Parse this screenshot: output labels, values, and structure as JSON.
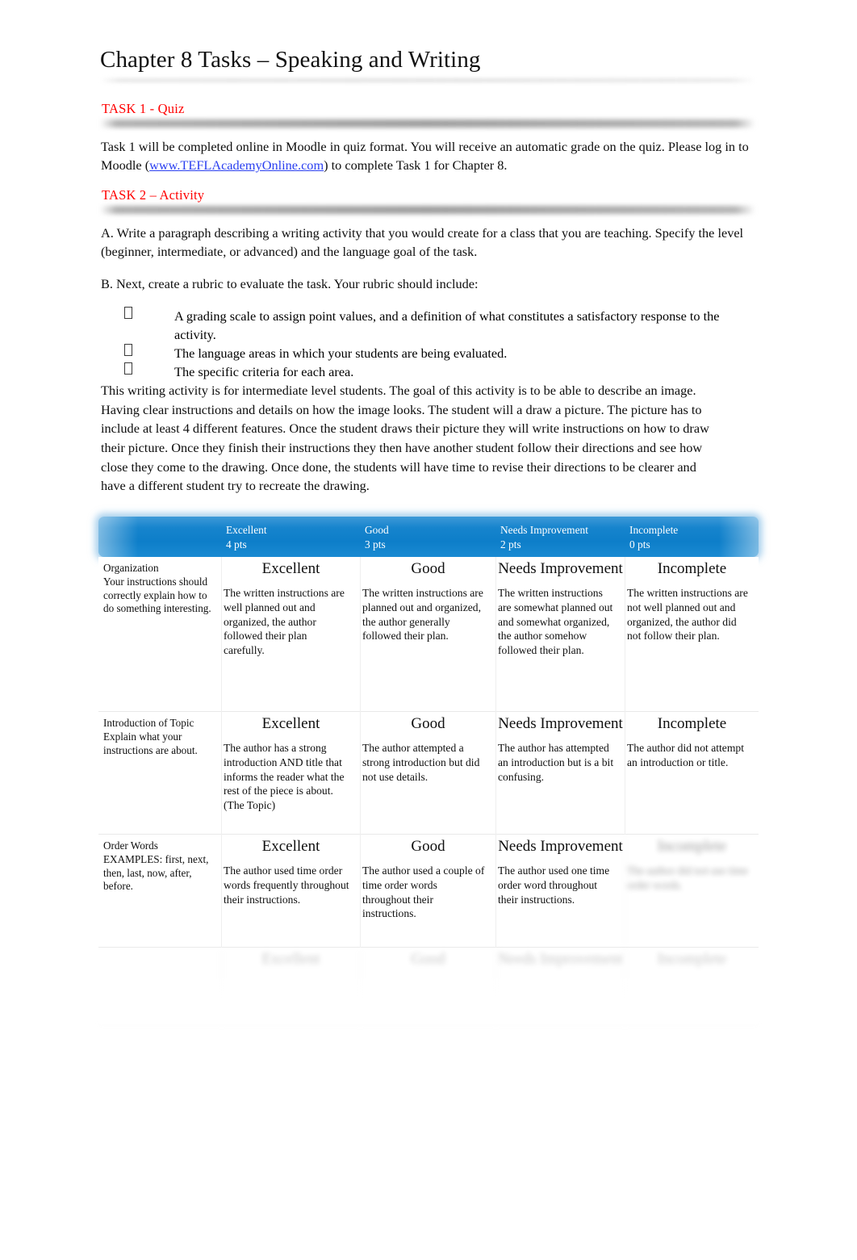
{
  "document": {
    "title": "Chapter 8 Tasks – Speaking and Writing"
  },
  "task1": {
    "heading": "TASK 1 - Quiz",
    "paragraph_before_link": "Task 1 will be completed online in Moodle in quiz format.  You will receive an automatic grade on the quiz.   Please log in to Moodle (",
    "link_text": "www.TEFLAcademyOnline.com",
    "paragraph_after_link": ") to complete Task 1 for Chapter 8."
  },
  "task2": {
    "heading": "TASK 2 – Activity",
    "part_a": "A. Write a paragraph describing a writing  activity that you would create for a class that you are teaching. Specify the level (beginner, intermediate, or advanced) and the language goal of the task.",
    "part_b": "B. Next, create a rubric to evaluate the task. Your rubric should include:",
    "bullets": [
      "A grading scale to assign point values, and a definition of what constitutes a satisfactory response to the activity.",
      "The language areas in which your students are being evaluated.",
      "The specific criteria for each area."
    ],
    "bullet_glyph": "missing-glyph-box",
    "response_paragraph": "This writing activity is for intermediate level students. The goal of this activity is to be able to describe an image. Having clear instructions and details on how the image looks. The student will a draw a picture. The picture has to include at least 4 different features. Once the student draws their picture they will write instructions on how to draw their picture. Once they finish their instructions they then have another student follow their directions and see how close they come to the drawing. Once done, the students will have time to revise their directions to be clearer and have a different student try to recreate the drawing."
  },
  "rubric": {
    "header_color": "#0d7ec9",
    "columns": [
      {
        "label": "",
        "points": ""
      },
      {
        "label": "Excellent",
        "points": "4 pts"
      },
      {
        "label": "Good",
        "points": "3 pts"
      },
      {
        "label": "Needs Improvement",
        "points": "2 pts"
      },
      {
        "label": "Incomplete",
        "points": "0 pts"
      }
    ],
    "rows": [
      {
        "criterion_title": "Organization",
        "criterion_detail": "Your instructions should correctly explain how to do something interesting.",
        "cells": [
          {
            "level": "Excellent",
            "description": "The written instructions are well planned out and organized, the author followed their plan carefully."
          },
          {
            "level": "Good",
            "description": "The written instructions are planned out and organized, the author generally followed their plan."
          },
          {
            "level": "Needs Improvement",
            "description": "The written instructions are somewhat planned out and somewhat organized, the author somehow followed their plan."
          },
          {
            "level": "Incomplete",
            "description": "The written instructions are not well planned out and organized, the author did not follow their plan."
          }
        ]
      },
      {
        "criterion_title": "Introduction of Topic",
        "criterion_detail": "Explain what your instructions are about.",
        "cells": [
          {
            "level": "Excellent",
            "description": "The author has a strong introduction AND title that informs the reader what the rest of the piece is about. (The Topic)"
          },
          {
            "level": "Good",
            "description": "The author attempted a strong introduction but did not use details."
          },
          {
            "level": "Needs Improvement",
            "description": "The author has attempted an introduction but is a bit confusing."
          },
          {
            "level": "Incomplete",
            "description": "The author did not attempt an introduction or title."
          }
        ]
      },
      {
        "criterion_title": "Order Words",
        "criterion_detail": "EXAMPLES: first, next, then, last, now, after, before.",
        "cells": [
          {
            "level": "Excellent",
            "description": "The author used time order words frequently throughout their instructions."
          },
          {
            "level": "Good",
            "description": "The author used a couple of time order words throughout their instructions."
          },
          {
            "level": "Needs Improvement",
            "description": "The author used one time order word throughout their instructions."
          },
          {
            "level": "Incomplete",
            "description": "The author did not use time order words."
          }
        ]
      },
      {
        "criterion_title": "",
        "criterion_detail": "",
        "cells": [
          {
            "level": "Excellent",
            "description": ""
          },
          {
            "level": "Good",
            "description": ""
          },
          {
            "level": "Needs Improvement",
            "description": ""
          },
          {
            "level": "Incomplete",
            "description": ""
          }
        ]
      }
    ]
  }
}
